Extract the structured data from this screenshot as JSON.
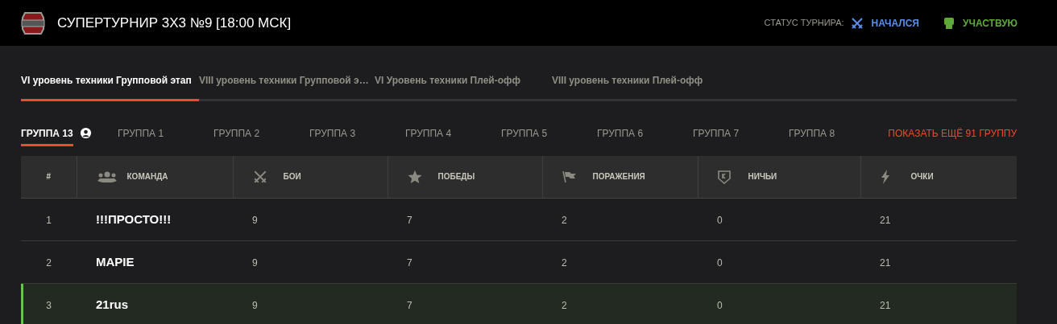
{
  "header": {
    "title": "СУПЕРТУРНИР 3Х3 №9 [18:00 МСК]",
    "status_label": "СТАТУС ТУРНИРА:",
    "status": "НАЧАЛСЯ",
    "participation": "УЧАСТВУЮ"
  },
  "stage_tabs": [
    {
      "label": "VI уровень техники Групповой этап",
      "selected": true
    },
    {
      "label": "VIII уровень техники Групповой э…",
      "selected": false
    },
    {
      "label": "VI Уровень техники Плей-офф",
      "selected": false
    },
    {
      "label": "VIII уровень техники Плей-офф",
      "selected": false
    }
  ],
  "group_tabs": [
    {
      "label": "ГРУППА 13",
      "selected": true,
      "own": true
    },
    {
      "label": "ГРУППА 1",
      "selected": false,
      "own": false
    },
    {
      "label": "ГРУППА 2",
      "selected": false,
      "own": false
    },
    {
      "label": "ГРУППА 3",
      "selected": false,
      "own": false
    },
    {
      "label": "ГРУППА 4",
      "selected": false,
      "own": false
    },
    {
      "label": "ГРУППА 5",
      "selected": false,
      "own": false
    },
    {
      "label": "ГРУППА 6",
      "selected": false,
      "own": false
    },
    {
      "label": "ГРУППА 7",
      "selected": false,
      "own": false
    },
    {
      "label": "ГРУППА 8",
      "selected": false,
      "own": false
    }
  ],
  "show_more": "ПОКАЗАТЬ ЕЩЁ 91 ГРУППУ",
  "table": {
    "columns": [
      {
        "label": "#",
        "kind": "rank"
      },
      {
        "label": "КОМАНДА",
        "kind": "team"
      },
      {
        "label": "БОИ",
        "kind": "battles"
      },
      {
        "label": "ПОБЕДЫ",
        "kind": "wins"
      },
      {
        "label": "ПОРАЖЕНИЯ",
        "kind": "losses"
      },
      {
        "label": "НИЧЬИ",
        "kind": "draws"
      },
      {
        "label": "ОЧКИ",
        "kind": "points"
      }
    ],
    "rows": [
      {
        "cells": [
          "1",
          "!!!ПРОСТО!!!",
          "9",
          "7",
          "2",
          "0",
          "21"
        ],
        "highlighted": false
      },
      {
        "cells": [
          "2",
          "MAPIE",
          "9",
          "7",
          "2",
          "0",
          "21"
        ],
        "highlighted": false
      },
      {
        "cells": [
          "3",
          "21rus",
          "9",
          "7",
          "2",
          "0",
          "21"
        ],
        "highlighted": true
      }
    ]
  }
}
